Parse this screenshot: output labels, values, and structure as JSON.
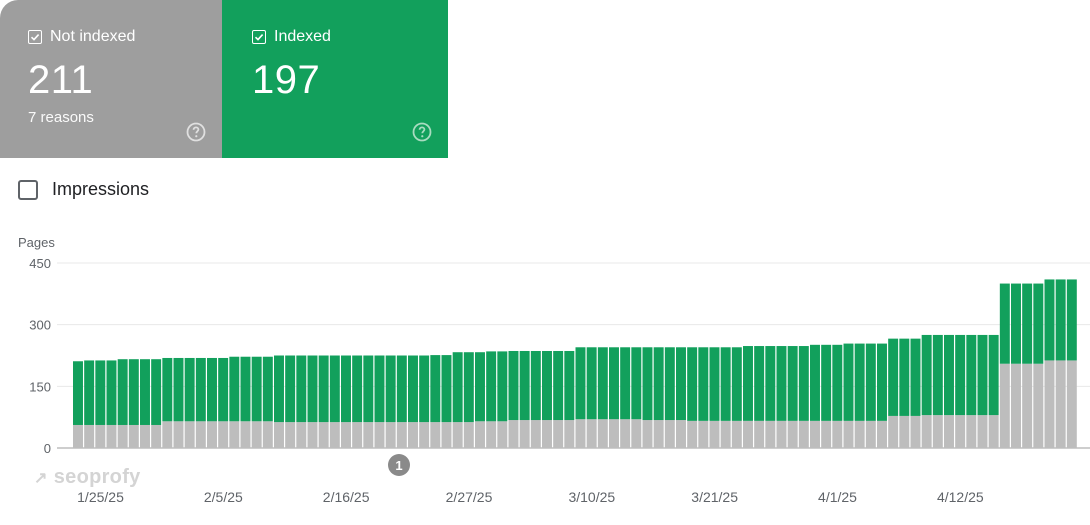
{
  "cards": {
    "not_indexed": {
      "label": "Not indexed",
      "count": "211",
      "sub": "7 reasons",
      "color": "#9e9e9e"
    },
    "indexed": {
      "label": "Indexed",
      "count": "197",
      "color": "#12a05c"
    }
  },
  "impressions": {
    "label": "Impressions",
    "checked": false
  },
  "watermark": "seoprofy",
  "annotation": "1",
  "chart_data": {
    "type": "bar",
    "stacked": true,
    "ylabel": "Pages",
    "ylim": [
      0,
      450
    ],
    "yticks": [
      "0",
      "150",
      "300",
      "450"
    ],
    "xtick_labels": [
      "1/25/25",
      "2/5/25",
      "2/16/25",
      "2/27/25",
      "3/10/25",
      "3/21/25",
      "4/1/25",
      "4/12/25"
    ],
    "grid": true,
    "series": [
      {
        "name": "Not indexed",
        "color": "#bdbdbd",
        "values": [
          56,
          56,
          56,
          56,
          56,
          56,
          56,
          56,
          65,
          65,
          65,
          65,
          65,
          65,
          65,
          65,
          65,
          65,
          63,
          63,
          63,
          63,
          63,
          63,
          63,
          63,
          63,
          63,
          63,
          63,
          63,
          63,
          63,
          63,
          63,
          63,
          65,
          65,
          65,
          68,
          68,
          68,
          68,
          68,
          68,
          70,
          70,
          70,
          70,
          70,
          70,
          68,
          68,
          68,
          68,
          66,
          66,
          66,
          66,
          66,
          66,
          66,
          66,
          66,
          66,
          66,
          66,
          66,
          66,
          66,
          66,
          66,
          66,
          78,
          78,
          78,
          80,
          80,
          80,
          80,
          80,
          80,
          80,
          205,
          205,
          205,
          205,
          213,
          213,
          213
        ]
      },
      {
        "name": "Indexed",
        "color": "#12a05c",
        "values": [
          155,
          157,
          157,
          157,
          160,
          160,
          160,
          160,
          154,
          154,
          154,
          154,
          154,
          154,
          157,
          157,
          157,
          157,
          162,
          162,
          162,
          162,
          162,
          162,
          162,
          162,
          162,
          162,
          162,
          162,
          162,
          162,
          163,
          163,
          170,
          170,
          168,
          170,
          170,
          168,
          168,
          168,
          168,
          168,
          168,
          175,
          175,
          175,
          175,
          175,
          175,
          177,
          177,
          177,
          177,
          179,
          179,
          179,
          179,
          179,
          182,
          182,
          182,
          182,
          182,
          182,
          185,
          185,
          185,
          188,
          188,
          188,
          188,
          188,
          188,
          188,
          195,
          195,
          195,
          195,
          195,
          195,
          195,
          195,
          195,
          195,
          195,
          197,
          197,
          197
        ]
      }
    ]
  }
}
